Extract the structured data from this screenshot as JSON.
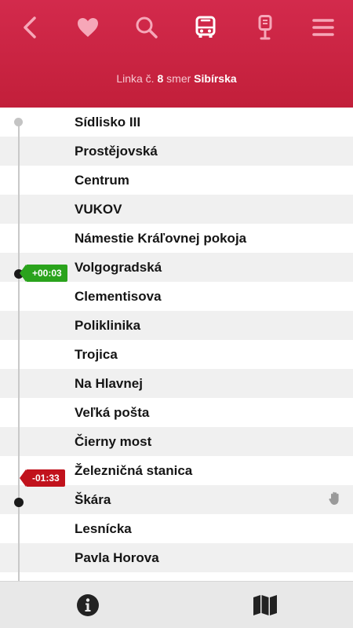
{
  "toolbar": {
    "icons": [
      "back-icon",
      "heart-icon",
      "search-icon",
      "bus-icon",
      "bus-stop-icon",
      "menu-icon"
    ],
    "icon_color": "#f6a7b8",
    "active_icon_color": "#ffffff"
  },
  "route": {
    "prefix": "Linka č.",
    "line_number": "8",
    "direction_word": "smer",
    "destination": "Sibírska"
  },
  "stops": [
    "Sídlisko III",
    "Prostějovská",
    "Centrum",
    "VUKOV",
    "Námestie Kráľovnej pokoja",
    "Volgogradská",
    "Clementisova",
    "Poliklinika",
    "Trojica",
    "Na Hlavnej",
    "Veľká pošta",
    "Čierny most",
    "Železničná stanica",
    "Škára",
    "Lesnícka",
    "Pavla Horova"
  ],
  "vehicles": [
    {
      "delay": "+00:03",
      "status_color": "#2aa31c"
    },
    {
      "delay": "-01:33",
      "status_color": "#c1121c"
    }
  ],
  "colors": {
    "header": "#c82240",
    "timeline": "#c9c9c9"
  },
  "bottom_bar": {
    "icons": [
      "info-icon",
      "map-icon"
    ]
  }
}
